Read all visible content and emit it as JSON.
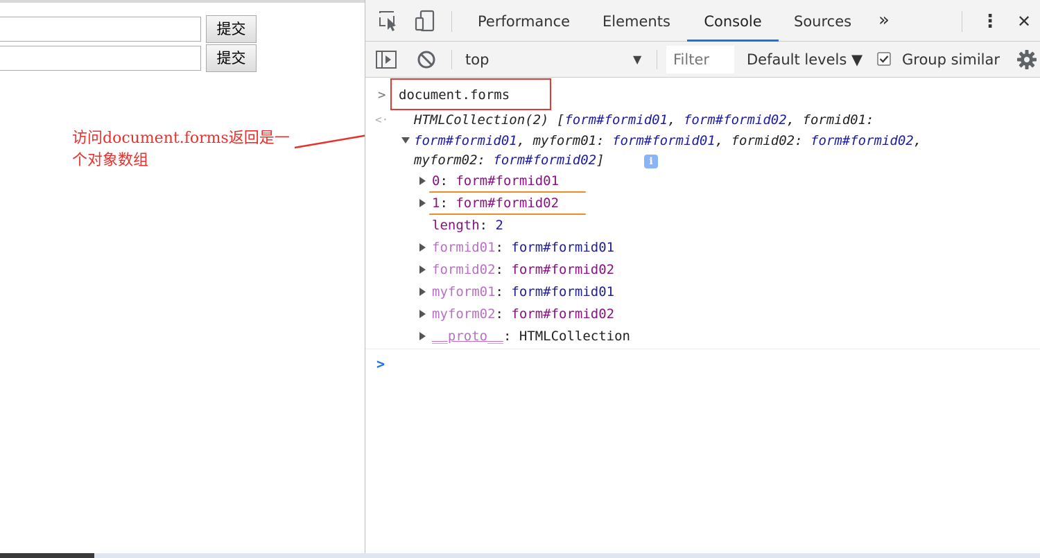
{
  "page": {
    "submit_label": "提交",
    "annotation": "访问document.forms返回是一个对象数组"
  },
  "devtools": {
    "tabs": [
      "Performance",
      "Elements",
      "Console",
      "Sources"
    ],
    "active_tab": "Console",
    "more_tabs_glyph": "»",
    "menu_glyph": "⋮",
    "close_glyph": "✕",
    "toolbar": {
      "context": "top",
      "filter_placeholder": "Filter",
      "levels": "Default levels ▼",
      "group_similar": "Group similar",
      "group_similar_checked": true
    },
    "console": {
      "command": "document.forms",
      "summary_line1": [
        "HTMLCollection(2) [",
        "form#formid01",
        ", ",
        "form#formid02",
        ", formid01:"
      ],
      "summary_line2": [
        "form#formid01",
        ", myform01: ",
        "form#formid01",
        ", formid02: ",
        "form#formid02",
        ","
      ],
      "summary_line3": [
        "myform02: ",
        "form#formid02",
        "]"
      ],
      "info_glyph": "i",
      "entries": [
        {
          "key": "0",
          "value": "form#formid01",
          "expandable": true,
          "underlined": true,
          "key_style": "purple"
        },
        {
          "key": "1",
          "value": "form#formid02",
          "expandable": true,
          "underlined": true,
          "key_style": "purple"
        },
        {
          "key": "length",
          "value": "2",
          "expandable": false,
          "underlined": false,
          "key_style": "purple"
        },
        {
          "key": "formid01",
          "value": "form#formid01",
          "expandable": true,
          "underlined": false,
          "key_style": "light"
        },
        {
          "key": "formid02",
          "value": "form#formid02",
          "expandable": true,
          "underlined": false,
          "key_style": "light"
        },
        {
          "key": "myform01",
          "value": "form#formid01",
          "expandable": true,
          "underlined": false,
          "key_style": "light"
        },
        {
          "key": "myform02",
          "value": "form#formid02",
          "expandable": true,
          "underlined": false,
          "key_style": "light"
        },
        {
          "key": "__proto__",
          "value": "HTMLCollection",
          "expandable": true,
          "underlined": false,
          "key_style": "proto"
        }
      ]
    }
  },
  "colors": {
    "accent": "#1a73e8",
    "annotation_red": "#e8302e",
    "underline_orange": "#f08a24",
    "key_purple": "#881280",
    "value_navy": "#1a1aa6"
  }
}
